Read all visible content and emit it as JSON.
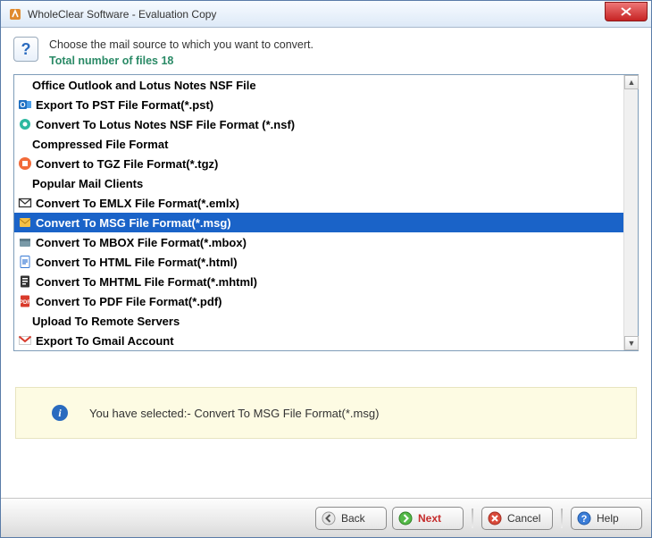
{
  "window": {
    "title": "WholeClear Software - Evaluation Copy"
  },
  "header": {
    "line1": "Choose the mail source to which you want to convert.",
    "line2_prefix": "Total number of files ",
    "file_count": "18"
  },
  "list": {
    "items": [
      {
        "kind": "header",
        "label": "Office Outlook and Lotus Notes NSF File"
      },
      {
        "kind": "item",
        "icon": "outlook-icon",
        "label": "Export To PST File Format(*.pst)"
      },
      {
        "kind": "item",
        "icon": "lotus-icon",
        "label": "Convert To Lotus Notes NSF File Format (*.nsf)"
      },
      {
        "kind": "header",
        "label": "Compressed File Format"
      },
      {
        "kind": "item",
        "icon": "tgz-icon",
        "label": "Convert to TGZ File Format(*.tgz)"
      },
      {
        "kind": "header",
        "label": "Popular Mail Clients"
      },
      {
        "kind": "item",
        "icon": "emlx-icon",
        "label": "Convert To EMLX File Format(*.emlx)"
      },
      {
        "kind": "item",
        "icon": "msg-icon",
        "label": "Convert To MSG File Format(*.msg)",
        "selected": true
      },
      {
        "kind": "item",
        "icon": "mbox-icon",
        "label": "Convert To MBOX File Format(*.mbox)"
      },
      {
        "kind": "item",
        "icon": "html-icon",
        "label": "Convert To HTML File Format(*.html)"
      },
      {
        "kind": "item",
        "icon": "mhtml-icon",
        "label": "Convert To MHTML File Format(*.mhtml)"
      },
      {
        "kind": "item",
        "icon": "pdf-icon",
        "label": "Convert To PDF File Format(*.pdf)"
      },
      {
        "kind": "header",
        "label": "Upload To Remote Servers"
      },
      {
        "kind": "item",
        "icon": "gmail-icon",
        "label": "Export To Gmail Account"
      }
    ]
  },
  "info": {
    "prefix": "You have selected:- ",
    "selection": "Convert To MSG File Format(*.msg)"
  },
  "buttons": {
    "back": "Back",
    "next": "Next",
    "cancel": "Cancel",
    "help": "Help"
  }
}
